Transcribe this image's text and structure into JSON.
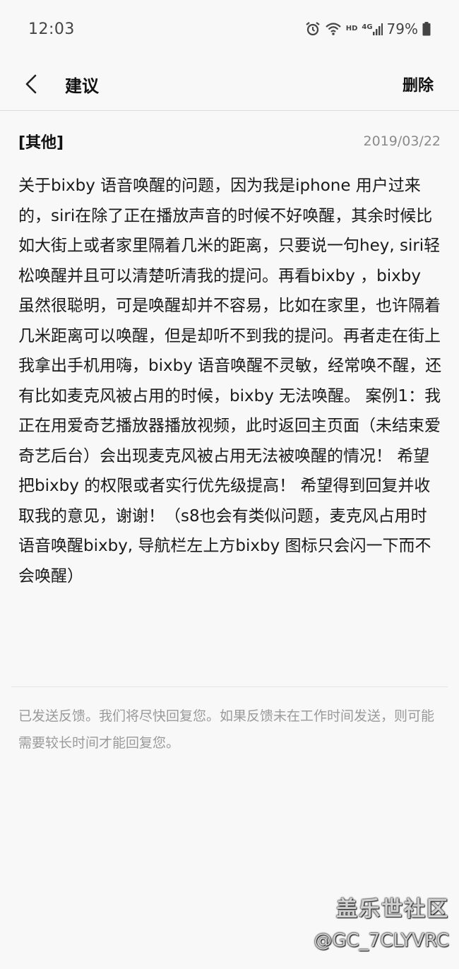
{
  "status_bar": {
    "time": "12:03",
    "hd": "HD",
    "network": "4G",
    "battery": "79%"
  },
  "header": {
    "title": "建议",
    "delete_label": "删除"
  },
  "message": {
    "category": "[其他]",
    "date": "2019/03/22",
    "body": "关于bixby 语音唤醒的问题，因为我是iphone 用户过来的，siri在除了正在播放声音的时候不好唤醒，其余时候比如大街上或者家里隔着几米的距离，只要说一句hey, siri轻松唤醒并且可以清楚听清我的提问。再看bixby ，bixby 虽然很聪明，可是唤醒却并不容易，比如在家里，也许隔着几米距离可以唤醒，但是却听不到我的提问。再者走在街上我拿出手机用嗨，bixby 语音唤醒不灵敏，经常唤不醒，还有比如麦克风被占用的时候，bixby 无法唤醒。 案例1：我正在用爱奇艺播放器播放视频，此时返回主页面（未结束爱奇艺后台）会出现麦克风被占用无法被唤醒的情况！ 希望把bixby 的权限或者实行优先级提高！ 希望得到回复并收取我的意见，谢谢！（s8也会有类似问题，麦克风占用时语音唤醒bixby, 导航栏左上方bixby 图标只会闪一下而不会唤醒）"
  },
  "notice": "已发送反馈。我们将尽快回复您。如果反馈未在工作时间发送，则可能需要较长时间才能回复您。",
  "watermark": {
    "brand": "盖乐世社区",
    "user": "@GC_7CLYVRC"
  }
}
